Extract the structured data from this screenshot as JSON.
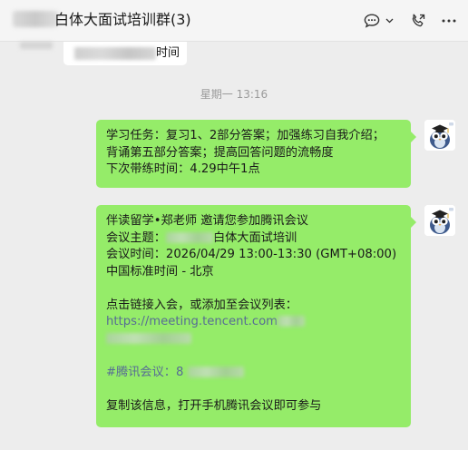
{
  "header": {
    "title": "白体大面试培训群(3)",
    "icons": [
      "chat-bubble-more-icon",
      "chevron-down-icon",
      "phone-icon",
      "more-icon"
    ]
  },
  "previous_message": {
    "text": "时间"
  },
  "timestamp": "星期一 13:16",
  "messages": [
    {
      "lines": [
        "学习任务：复习1、2部分答案；加强练习自我介绍；",
        "背诵第五部分答案；提高回答问题的流畅度",
        "下次带练时间：4.29中午1点"
      ]
    },
    {
      "inviter": "伴读留学•郑老师 邀请您参加腾讯会议",
      "topic_prefix": "会议主题：",
      "topic_suffix": "白体大面试培训",
      "time_line": "会议时间：2026/04/29 13:00-13:30 (GMT+08:00)",
      "timezone_line": "中国标准时间 - 北京",
      "click_line": "点击链接入会，或添加至会议列表：",
      "link": "https://meeting.tencent.com",
      "meeting_id_prefix": "#腾讯会议：8",
      "copy_line": "复制该信息，打开手机腾讯会议即可参与"
    }
  ]
}
